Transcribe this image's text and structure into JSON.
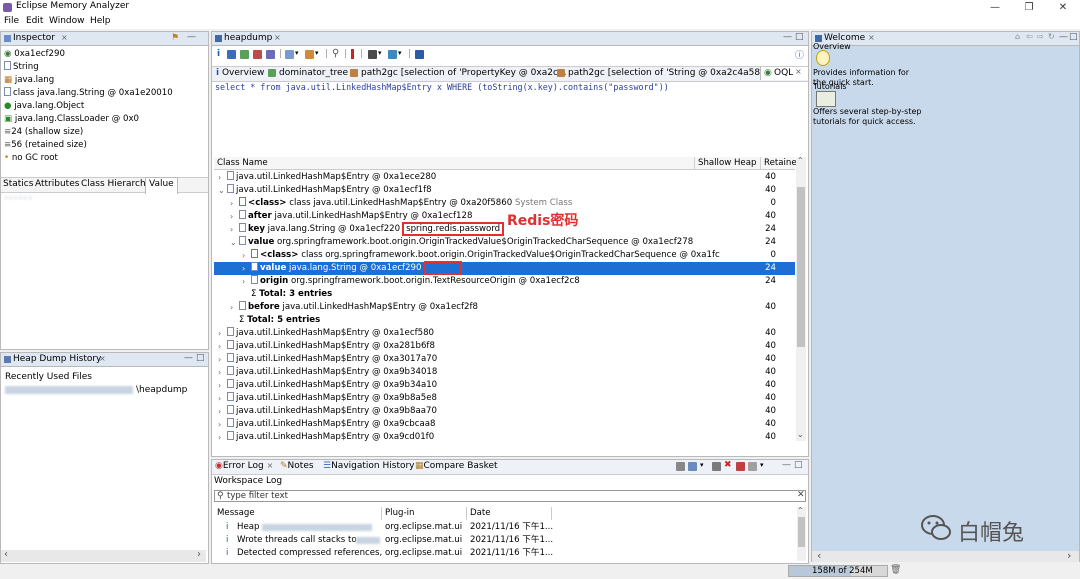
{
  "app": {
    "title": "Eclipse Memory Analyzer"
  },
  "menu": [
    "File",
    "Edit",
    "Window",
    "Help"
  ],
  "inspector": {
    "tab_label": "Inspector",
    "items": [
      "0xa1ecf290",
      "String",
      "java.lang",
      "class java.lang.String @ 0xa1e20010",
      "java.lang.Object",
      "java.lang.ClassLoader @ 0x0",
      "24 (shallow size)",
      "56 (retained size)",
      "no GC root"
    ],
    "subtabs": [
      "Statics",
      "Attributes",
      "Class Hierarchy",
      "Value"
    ],
    "value_blurred": "••••••"
  },
  "heap_history": {
    "tab_label": "Heap Dump History",
    "recent_label": "Recently Used Files",
    "file_suffix": "\\heapdump"
  },
  "editor": {
    "tab_label": "heapdump",
    "subtabs": [
      "Overview",
      "dominator_tree",
      "path2gc  [selection of 'PropertyKey @ 0xa2c...",
      "path2gc  [selection of 'String @ 0xa2c4a588 ...",
      "OQL"
    ],
    "query": "select * from java.util.LinkedHashMap$Entry x WHERE (toString(x.key).contains(\"password\"))",
    "columns": [
      "Class Name",
      "Shallow Heap",
      "Retaine"
    ],
    "rows": [
      {
        "indent": 0,
        "tri": "›",
        "icon": "file",
        "text": "java.util.LinkedHashMap$Entry @ 0xa1ece280",
        "shallow": "40"
      },
      {
        "indent": 0,
        "tri": "⌄",
        "icon": "file",
        "text": "java.util.LinkedHashMap$Entry @ 0xa1ecf1f8",
        "shallow": "40"
      },
      {
        "indent": 1,
        "tri": "›",
        "icon": "class",
        "bold": "<class>",
        "text": " class java.util.LinkedHashMap$Entry @ 0xa20f5860",
        "gray": " System Class",
        "shallow": "0"
      },
      {
        "indent": 1,
        "tri": "›",
        "icon": "file",
        "bold": "after",
        "text": " java.util.LinkedHashMap$Entry @ 0xa1ecf128",
        "shallow": "40"
      },
      {
        "indent": 1,
        "tri": "›",
        "icon": "file",
        "bold": "key",
        "text": " java.lang.String @ 0xa1ecf220",
        "boxed": "spring.redis.password",
        "shallow": "24"
      },
      {
        "indent": 1,
        "tri": "⌄",
        "icon": "file",
        "bold": "value",
        "text": " org.springframework.boot.origin.OriginTrackedValue$OriginTrackedCharSequence @ 0xa1ecf278",
        "shallow": "24"
      },
      {
        "indent": 2,
        "tri": "›",
        "icon": "class",
        "bold": "<class>",
        "text": " class org.springframework.boot.origin.OriginTrackedValue$OriginTrackedCharSequence @ 0xa1fc",
        "shallow": "0"
      },
      {
        "indent": 2,
        "tri": "›",
        "icon": "file",
        "bold": "value",
        "text": " java.lang.String @ 0xa1ecf290",
        "boxed": "••••••",
        "shallow": "24",
        "selected": true
      },
      {
        "indent": 2,
        "tri": "›",
        "icon": "file",
        "bold": "origin",
        "text": " org.springframework.boot.origin.TextResourceOrigin @ 0xa1ecf2c8",
        "shallow": "24"
      },
      {
        "indent": 2,
        "tri": "",
        "icon": "sigma",
        "bold": "Total: 3 entries",
        "text": "",
        "shallow": ""
      },
      {
        "indent": 1,
        "tri": "›",
        "icon": "file",
        "bold": "before",
        "text": " java.util.LinkedHashMap$Entry @ 0xa1ecf2f8",
        "shallow": "40"
      },
      {
        "indent": 1,
        "tri": "",
        "icon": "sigma",
        "bold": "Total: 5 entries",
        "text": "",
        "shallow": ""
      },
      {
        "indent": 0,
        "tri": "›",
        "icon": "file",
        "text": "java.util.LinkedHashMap$Entry @ 0xa1ecf580",
        "shallow": "40"
      },
      {
        "indent": 0,
        "tri": "›",
        "icon": "file",
        "text": "java.util.LinkedHashMap$Entry @ 0xa281b6f8",
        "shallow": "40"
      },
      {
        "indent": 0,
        "tri": "›",
        "icon": "file",
        "text": "java.util.LinkedHashMap$Entry @ 0xa3017a70",
        "shallow": "40"
      },
      {
        "indent": 0,
        "tri": "›",
        "icon": "file",
        "text": "java.util.LinkedHashMap$Entry @ 0xa9b34018",
        "shallow": "40"
      },
      {
        "indent": 0,
        "tri": "›",
        "icon": "file",
        "text": "java.util.LinkedHashMap$Entry @ 0xa9b34a10",
        "shallow": "40"
      },
      {
        "indent": 0,
        "tri": "›",
        "icon": "file",
        "text": "java.util.LinkedHashMap$Entry @ 0xa9b8a5e8",
        "shallow": "40"
      },
      {
        "indent": 0,
        "tri": "›",
        "icon": "file",
        "text": "java.util.LinkedHashMap$Entry @ 0xa9b8aa70",
        "shallow": "40"
      },
      {
        "indent": 0,
        "tri": "›",
        "icon": "file",
        "text": "java.util.LinkedHashMap$Entry @ 0xa9cbcaa8",
        "shallow": "40"
      },
      {
        "indent": 0,
        "tri": "›",
        "icon": "file",
        "text": "java.util.LinkedHashMap$Entry @ 0xa9cd01f0",
        "shallow": "40"
      }
    ],
    "annotation": "Redis密码"
  },
  "welcome": {
    "tab_label": "Welcome",
    "items": [
      {
        "title": "Overview",
        "desc": "Provides information for the quick start."
      },
      {
        "title": "Tutorials",
        "desc": "Offers several step-by-step tutorials for quick access."
      }
    ]
  },
  "errorlog": {
    "tabs": [
      "Error Log",
      "Notes",
      "Navigation History",
      "Compare Basket"
    ],
    "workspace_label": "Workspace Log",
    "filter_placeholder": "type filter text",
    "columns": [
      "Message",
      "Plug-in",
      "Date"
    ],
    "rows": [
      {
        "message": "Heap",
        "plugin": "org.eclipse.mat.ui",
        "date": "2021/11/16 下午1..."
      },
      {
        "message": "Wrote threads call stacks to",
        "plugin": "org.eclipse.mat.ui",
        "date": "2021/11/16 下午1..."
      },
      {
        "message": "Detected compressed references, I",
        "plugin": "org.eclipse.mat.ui",
        "date": "2021/11/16 下午1..."
      }
    ]
  },
  "status": {
    "memory": "158M of 254M"
  },
  "watermark": "白帽兔",
  "colors": {
    "selection": "#1e6fd3",
    "annotation": "#e03030",
    "tab_bg": "#dfe7f3"
  }
}
